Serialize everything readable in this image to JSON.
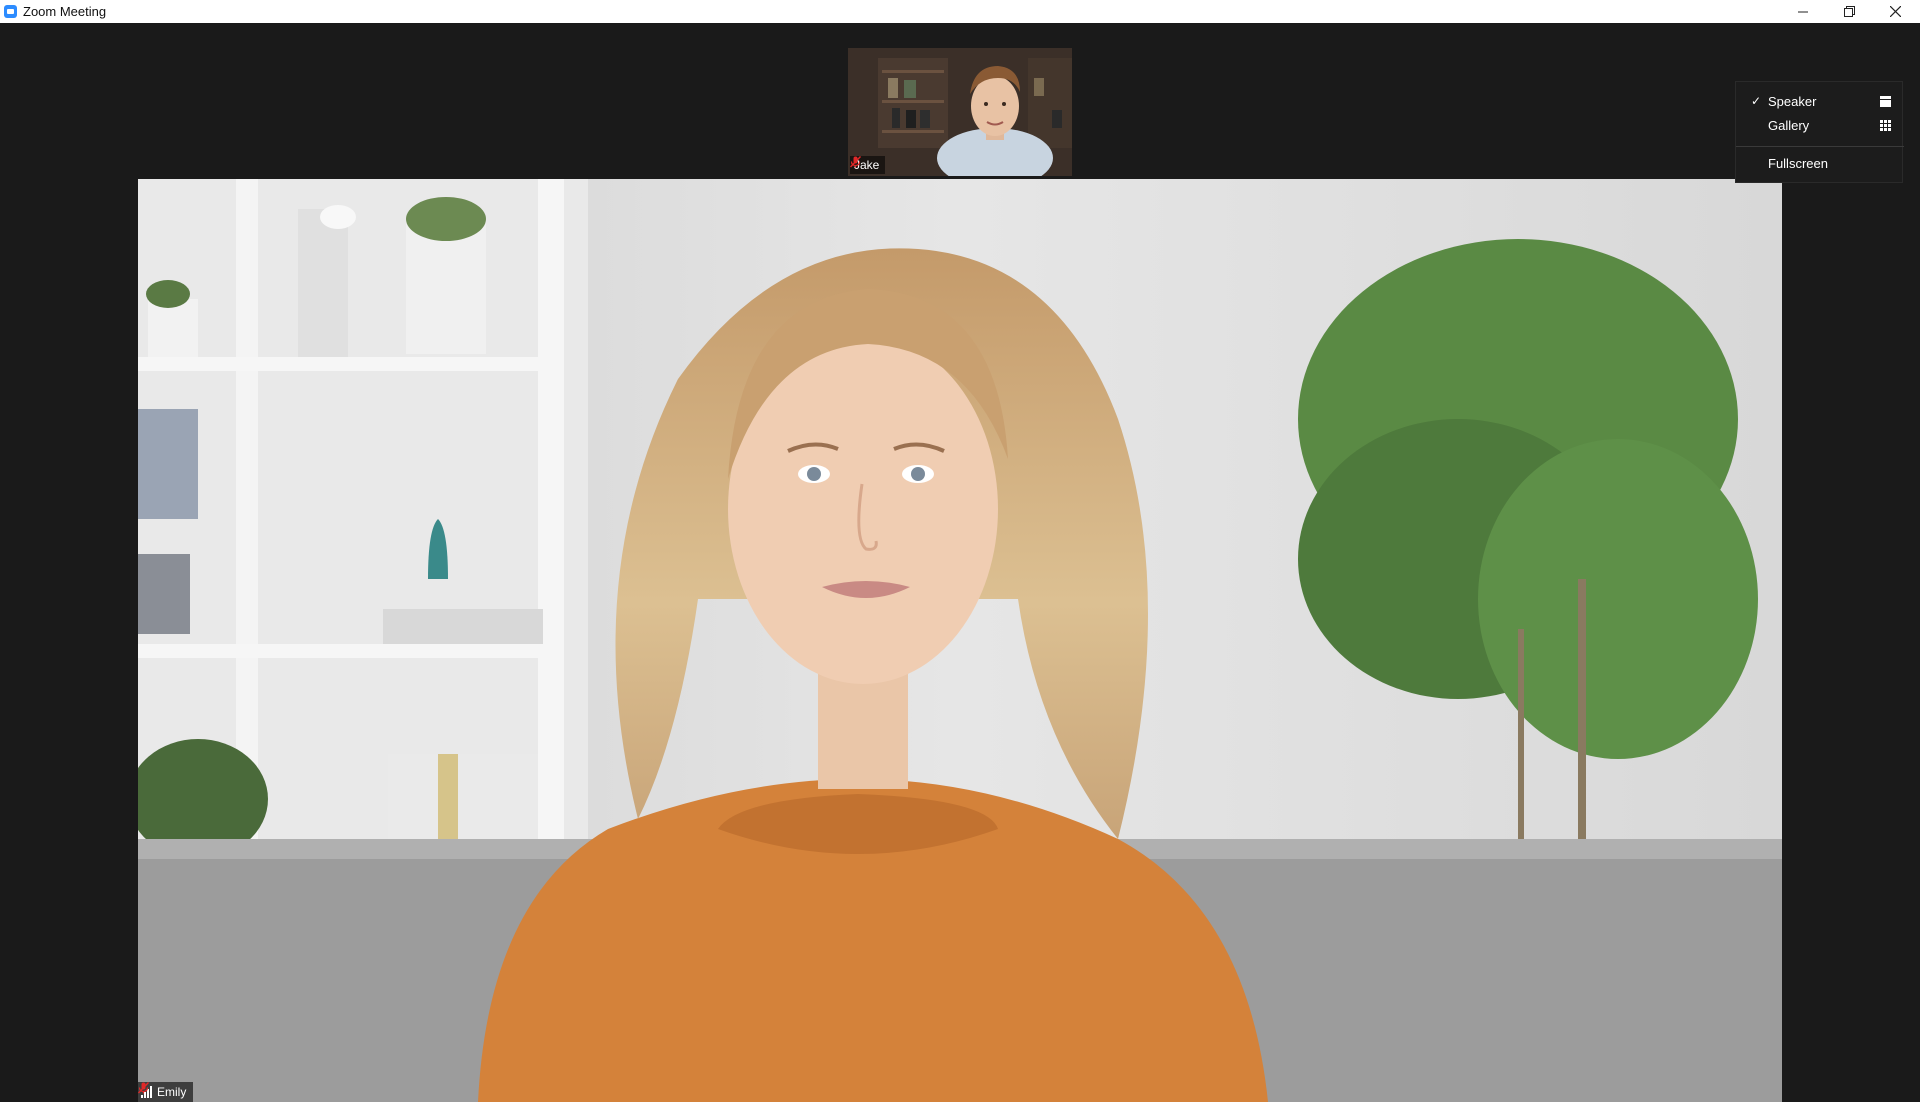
{
  "window": {
    "title": "Zoom Meeting"
  },
  "thumbnail": {
    "participant_name": "Jake",
    "muted": true
  },
  "main_video": {
    "participant_name": "Emily",
    "muted": true
  },
  "view_menu": {
    "items": [
      {
        "label": "Speaker",
        "checked": true,
        "icon": "speaker-view-icon"
      },
      {
        "label": "Gallery",
        "checked": false,
        "icon": "gallery-view-icon"
      },
      {
        "label": "Fullscreen",
        "checked": false,
        "icon": ""
      }
    ]
  },
  "colors": {
    "background": "#1a1a1a",
    "muted_icon": "#e02828",
    "titlebar": "#ffffff"
  }
}
